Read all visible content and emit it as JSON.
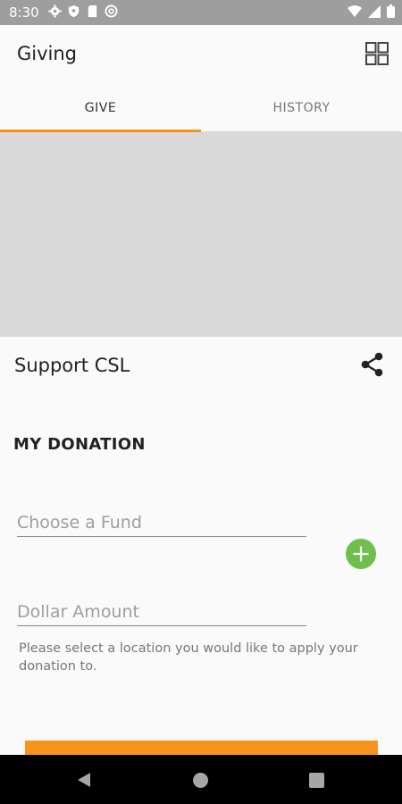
{
  "status_bar": {
    "time": "8:30",
    "icons": [
      "settings-icon",
      "shield-icon",
      "sd-card-icon",
      "sync-icon"
    ],
    "right_icons": [
      "wifi-icon",
      "signal-icon",
      "battery-icon"
    ]
  },
  "app_bar": {
    "title": "Giving",
    "menu_icon": "grid-icon"
  },
  "tabs": [
    {
      "label": "GIVE",
      "selected": true
    },
    {
      "label": "HISTORY",
      "selected": false
    }
  ],
  "colors": {
    "accent": "#f7941d",
    "add_button": "#6fbf4a",
    "banner": "#d9d9d9"
  },
  "campaign": {
    "title": "Support CSL",
    "share_icon": "share-icon"
  },
  "donation": {
    "section_title": "MY DONATION",
    "fund_placeholder": "Choose a Fund",
    "amount_placeholder": "Dollar Amount",
    "add_icon": "plus-icon",
    "helper_text": "Please select a location you would like to apply your donation to."
  },
  "nav_bar": {
    "icons": [
      "back-icon",
      "home-icon",
      "recents-icon"
    ]
  }
}
